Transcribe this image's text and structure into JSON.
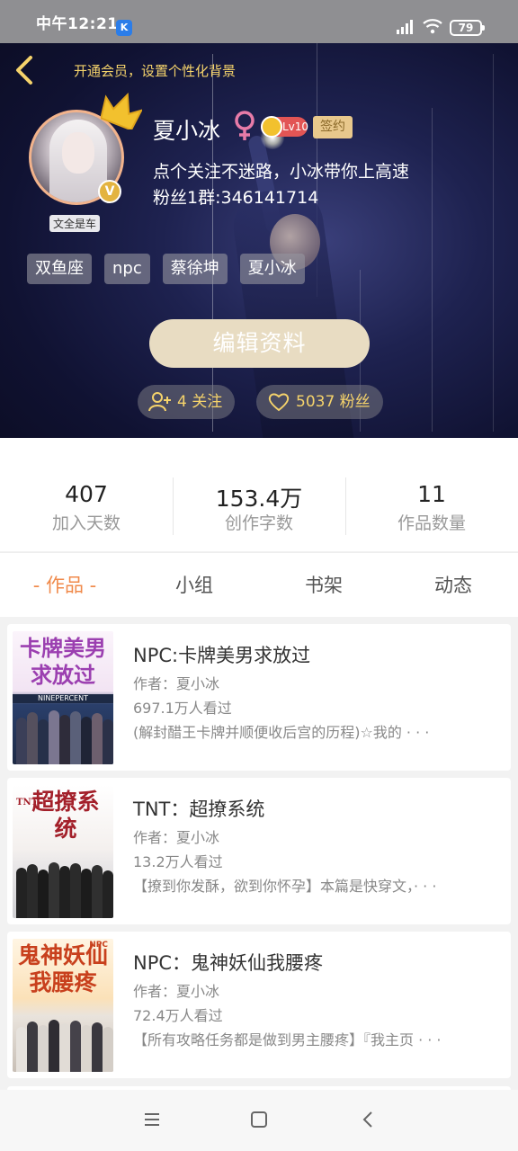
{
  "status_bar": {
    "time": "中午12:21",
    "app_icon": "K",
    "battery": "79"
  },
  "header": {
    "vip_tip": "开通会员，设置个性化背景",
    "avatar_caption": "文全是车",
    "v_badge": "V",
    "username": "夏小冰",
    "level": "Lv10",
    "sign_badge": "签约",
    "bio_line1": "点个关注不迷路，小冰带你上高速",
    "bio_line2": "粉丝1群:346141714",
    "tags": [
      "双鱼座",
      "npc",
      "蔡徐坤",
      "夏小冰"
    ],
    "edit_button": "编辑资料",
    "following": "4 关注",
    "fans": "5037 粉丝"
  },
  "stats": [
    {
      "value": "407",
      "label": "加入天数"
    },
    {
      "value": "153.4万",
      "label": "创作字数"
    },
    {
      "value": "11",
      "label": "作品数量"
    }
  ],
  "tabs": [
    "- 作品 -",
    "小组",
    "书架",
    "动态"
  ],
  "books": [
    {
      "cover_title": "卡牌美男求放过",
      "cover_sub": "NINEPERCENT",
      "title": "NPC:卡牌美男求放过",
      "author": "作者：夏小冰",
      "views": "697.1万人看过",
      "desc": "(解封醋王卡牌并顺便收后宫的历程)☆我的 · · ·"
    },
    {
      "cover_title": "超撩系统",
      "cover_sub": "TNT",
      "title": "TNT：超撩系统",
      "author": "作者：夏小冰",
      "views": "13.2万人看过",
      "desc": "【撩到你发酥，欲到你怀孕】本篇是快穿文，· · ·"
    },
    {
      "cover_title": "鬼神妖仙我腰疼",
      "cover_sub": "NPC",
      "title": "NPC：鬼神妖仙我腰疼",
      "author": "作者：夏小冰",
      "views": "72.4万人看过",
      "desc": "【所有攻略任务都是做到男主腰疼】『我主页 · · ·"
    }
  ],
  "colors": {
    "accent": "#f08a4b",
    "gold": "#f5d36b",
    "level_red": "#e25555"
  }
}
